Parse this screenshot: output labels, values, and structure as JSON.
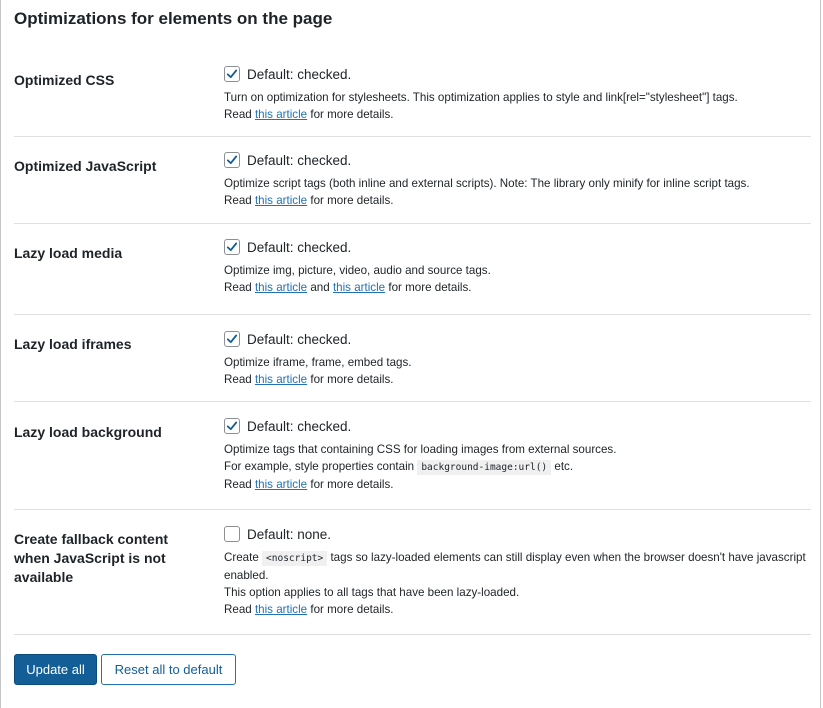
{
  "page_title": "Optimizations for elements on the page",
  "settings": [
    {
      "label": "Optimized CSS",
      "checked": true,
      "check_text": "Default: checked.",
      "desc_line1": "Turn on optimization for stylesheets. This optimization applies to style and link[rel=\"stylesheet\"] tags.",
      "read_prefix": "Read ",
      "link1": "this article",
      "read_suffix": " for more details."
    },
    {
      "label": "Optimized JavaScript",
      "checked": true,
      "check_text": "Default: checked.",
      "desc_line1": "Optimize script tags (both inline and external scripts). Note: The library only minify for inline script tags.",
      "read_prefix": "Read ",
      "link1": "this article",
      "read_suffix": " for more details."
    },
    {
      "label": "Lazy load media",
      "checked": true,
      "check_text": "Default: checked.",
      "desc_line1": "Optimize img, picture, video, audio and source tags.",
      "read_prefix": "Read ",
      "link1": "this article",
      "read_middle": " and ",
      "link2": "this article",
      "read_suffix": " for more details."
    },
    {
      "label": "Lazy load iframes",
      "checked": true,
      "check_text": "Default: checked.",
      "desc_line1": "Optimize iframe, frame, embed tags.",
      "read_prefix": "Read ",
      "link1": "this article",
      "read_suffix": " for more details."
    },
    {
      "label": "Lazy load background",
      "checked": true,
      "check_text": "Default: checked.",
      "desc_line1": "Optimize tags that containing CSS for loading images from external sources.",
      "desc_line2_prefix": "For example, style properties contain ",
      "desc_line2_code": "background-image:url()",
      "desc_line2_suffix": " etc.",
      "read_prefix": "Read ",
      "link1": "this article",
      "read_suffix": " for more details."
    },
    {
      "label": "Create fallback content when JavaScript is not available",
      "checked": false,
      "check_text": "Default: none.",
      "desc_line1_prefix": "Create ",
      "desc_line1_code": "<noscript>",
      "desc_line1_suffix": " tags so lazy-loaded elements can still display even when the browser doesn't have javascript enabled.",
      "desc_line2": "This option applies to all tags that have been lazy-loaded.",
      "read_prefix": "Read ",
      "link1": "this article",
      "read_suffix": " for more details."
    }
  ],
  "buttons": {
    "update_all": "Update all",
    "reset_all": "Reset all to default"
  },
  "colors": {
    "primary_button": "#135e96",
    "link": "#2271b1",
    "checkmark": "#135e96"
  },
  "icons": {
    "checked": "checkmark-icon"
  }
}
